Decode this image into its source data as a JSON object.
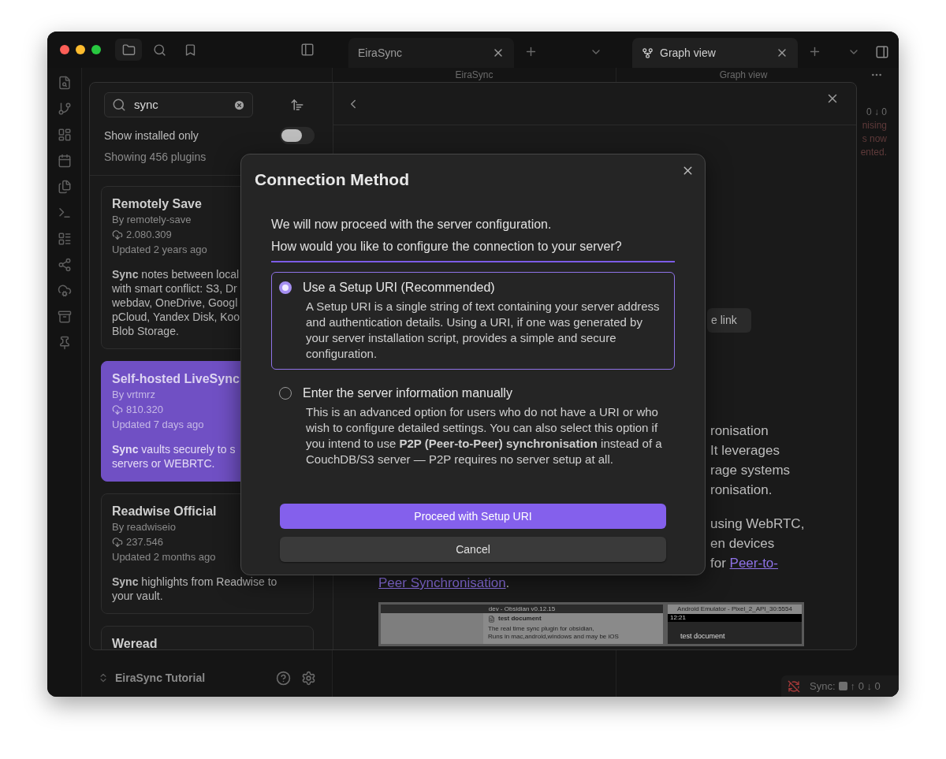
{
  "tabs": [
    {
      "label": "EiraSync",
      "selected": false,
      "kind": "note"
    },
    {
      "label": "Graph view",
      "selected": true,
      "kind": "graph"
    }
  ],
  "view_headers": [
    "EiraSync",
    "Graph view"
  ],
  "status_panel": [
    "0 ↓ 0",
    "nising",
    "s now",
    "ented."
  ],
  "vault": {
    "name": "EiraSync Tutorial"
  },
  "status_bar": {
    "label": "Sync:",
    "counts": "↑ 0 ↓ 0"
  },
  "plugin_browser": {
    "search": {
      "value": "sync"
    },
    "show_installed": {
      "label": "Show installed only",
      "on": false
    },
    "count": "Showing 456 plugins",
    "plugins": [
      {
        "name": "Remotely Save",
        "author": "By remotely-save",
        "downloads": "2.080.309",
        "updated": "Updated 2 years ago",
        "description": [
          "**Sync** notes between local",
          "with smart conflict: S3, Dr",
          "webdav, OneDrive, Googl",
          "pCloud, Yandex Disk, Koo",
          "Blob Storage."
        ],
        "selected": false
      },
      {
        "name": "Self-hosted Live**Sync**",
        "author": "By vrtmrz",
        "downloads": "810.320",
        "updated": "Updated 7 days ago",
        "description": [
          "**Sync** vaults securely to s",
          "servers or WEBRTC."
        ],
        "selected": true
      },
      {
        "name": "Readwise Official",
        "author": "By readwiseio",
        "downloads": "237.546",
        "updated": "Updated 2 months ago",
        "description": [
          "**Sync** highlights from Readwise to",
          "your vault."
        ],
        "selected": false
      },
      {
        "name": "Weread",
        "selected": false
      }
    ]
  },
  "plugin_detail": {
    "link_button": "e link",
    "lines_a": [
      "ronisation",
      "It leverages",
      "rage systems",
      "ronisation."
    ],
    "lines_b": [
      "using WebRTC,",
      "en devices"
    ],
    "link_line": {
      "text": "for ",
      "link": "Peer-to-"
    },
    "last_line": {
      "link": "Peer Synchronisation",
      "text": "."
    },
    "screenshot": {
      "desktop_title": "dev - Obsidian v0.12.15",
      "desktop_doc": "test document",
      "desktop_body": [
        "The real time sync plugin for obsidian,",
        "Runs in mac,android,windows and may be iOS"
      ],
      "emulator_title": "Android Emulator - Pixel_2_API_30:5554",
      "emulator_time": "12:21",
      "emulator_doc": "test document"
    }
  },
  "dialog": {
    "title": "Connection Method",
    "intro": [
      "We will now proceed with the server configuration.",
      "How would you like to configure the connection to your server?"
    ],
    "options": [
      {
        "label": "Use a Setup URI (Recommended)",
        "description": "A Setup URI is a single string of text containing your server address and authentication details. Using a URI, if one was generated by your server installation script, provides a simple and secure configuration.",
        "selected": true
      },
      {
        "label": "Enter the server information manually",
        "description": "This is an advanced option for users who do not have a URI or who wish to configure detailed settings. You can also select this option if you intend to use **P2P (Peer-to-Peer) synchronisation** instead of a CouchDB/S3 server — P2P requires no server setup at all.",
        "selected": false
      }
    ],
    "buttons": [
      {
        "label": "Proceed with Setup URI",
        "kind": "primary"
      },
      {
        "label": "Cancel",
        "kind": "secondary"
      }
    ]
  }
}
